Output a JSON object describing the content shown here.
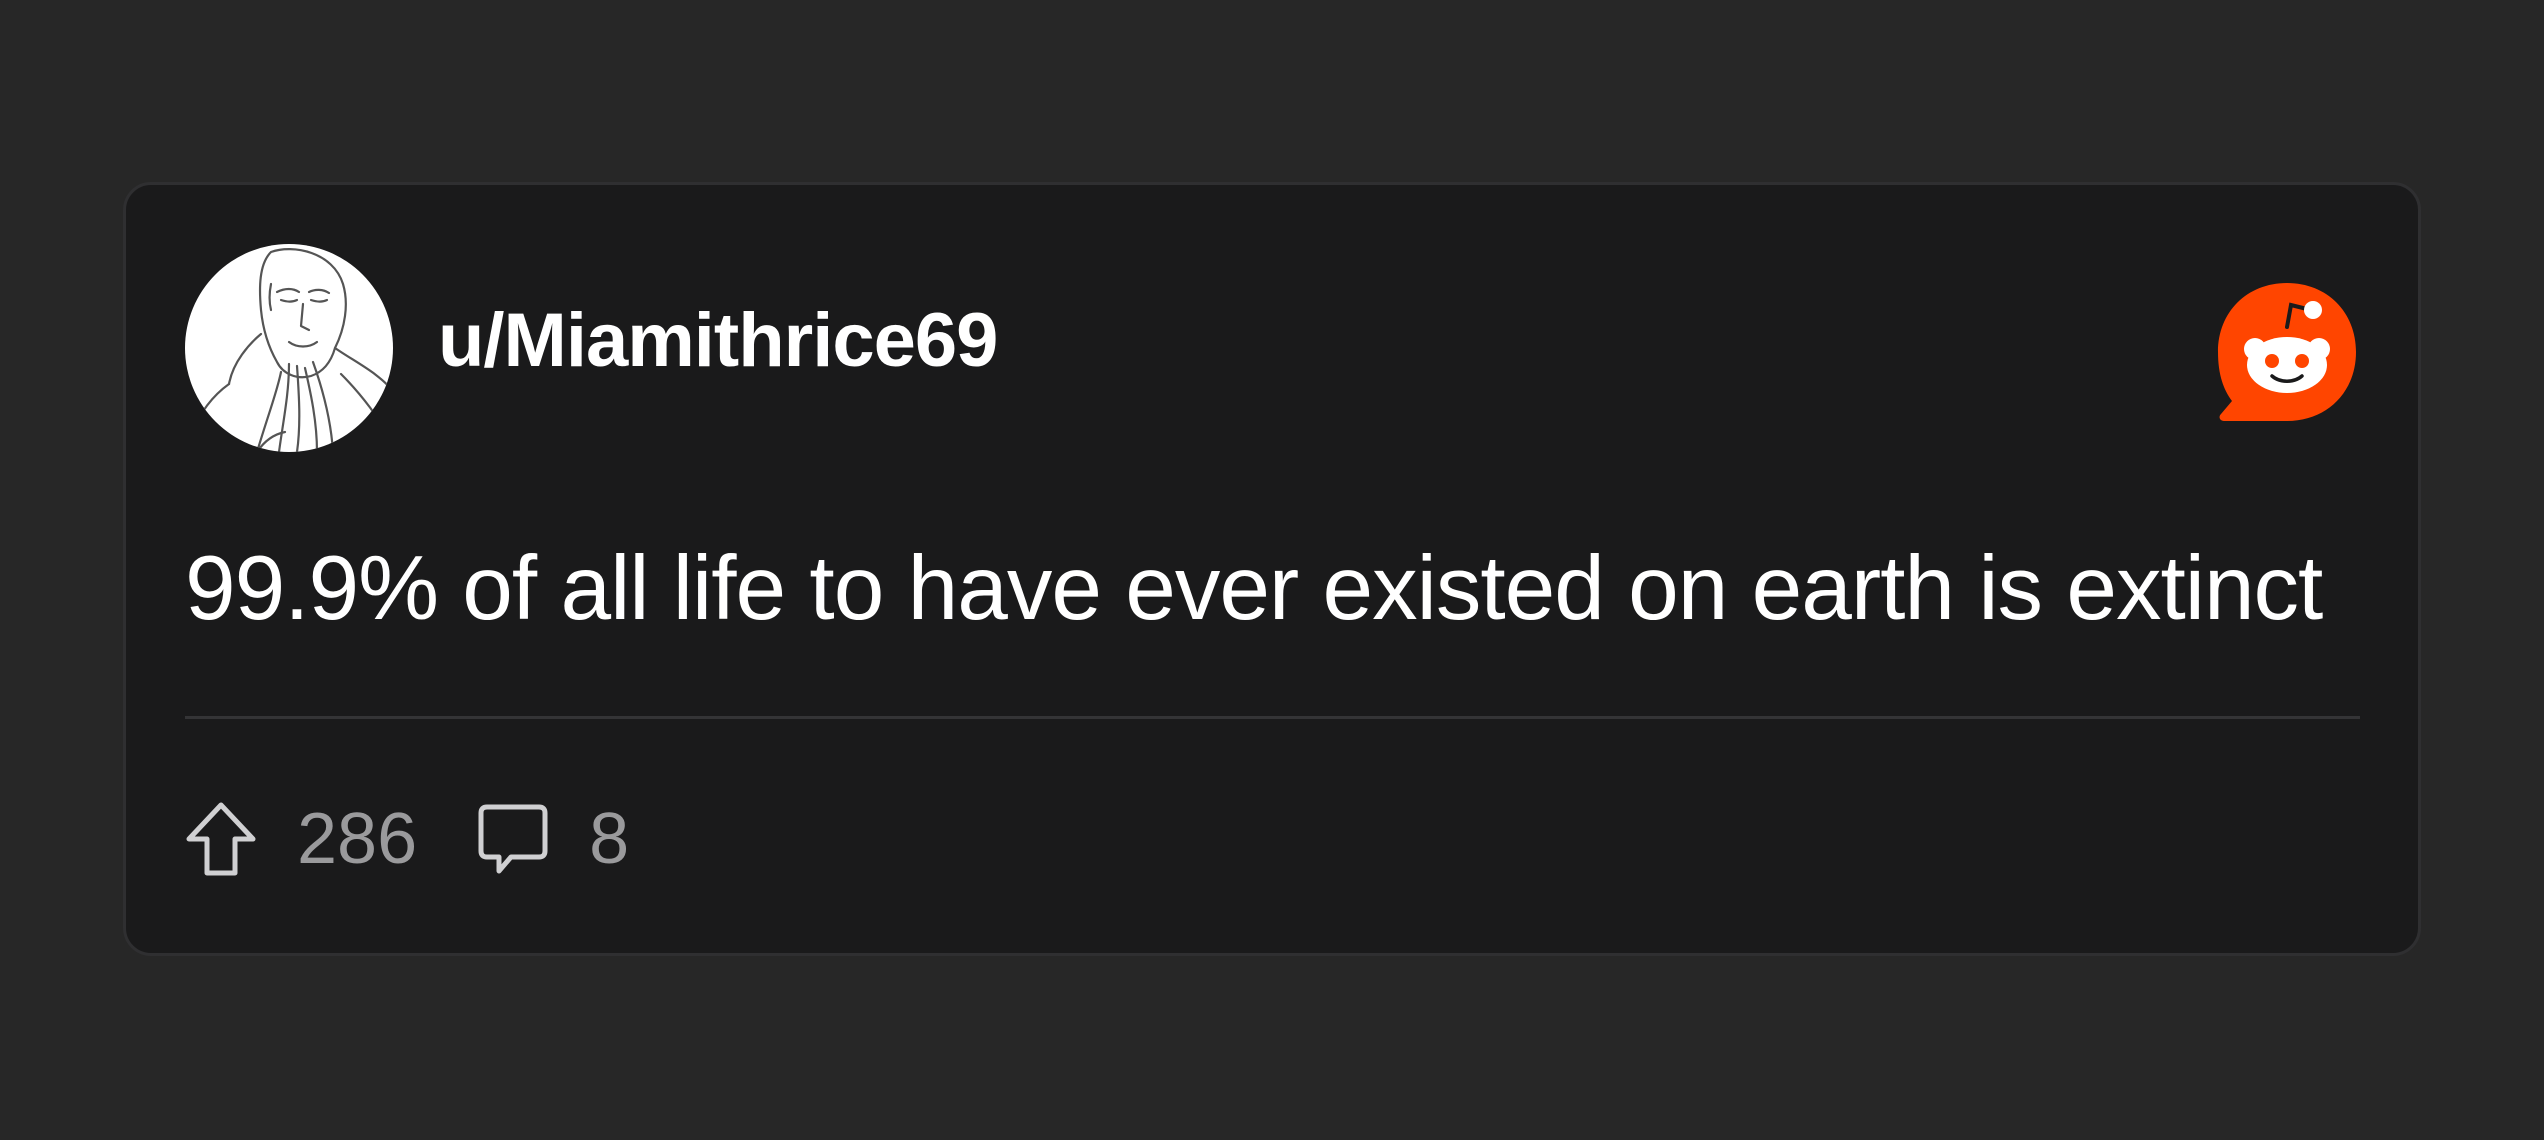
{
  "post": {
    "username": "u/Miamithrice69",
    "title": "99.9% of all life to have ever existed on earth is extinct",
    "upvotes": "286",
    "comments": "8"
  },
  "icons": {
    "avatar": "wojak-chad-avatar",
    "brand": "reddit-logo-icon",
    "upvote": "upvote-arrow-icon",
    "comment": "comment-bubble-icon"
  },
  "colors": {
    "background": "#272727",
    "card": "#1a1a1b",
    "brand": "#ff4500",
    "text": "#ffffff",
    "muted": "#9a9a9c"
  }
}
